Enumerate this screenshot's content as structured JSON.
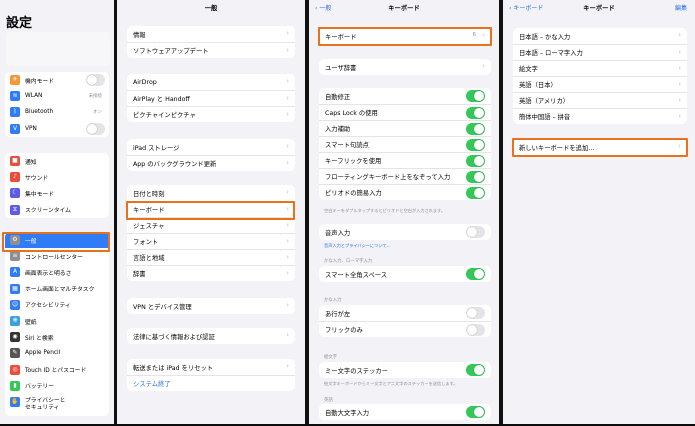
{
  "sidebar": {
    "title": "設定",
    "group1": [
      {
        "label": "機内モード",
        "icon": "airplane-icon",
        "glyph": "✈",
        "color": "#f29a38",
        "toggle": false
      },
      {
        "label": "WLAN",
        "icon": "wifi-icon",
        "glyph": "≋",
        "color": "#2f7cf6",
        "value": "未接続"
      },
      {
        "label": "Bluetooth",
        "icon": "bluetooth-icon",
        "glyph": "ᛒ",
        "color": "#2f7cf6",
        "value": "オン"
      },
      {
        "label": "VPN",
        "icon": "vpn-icon",
        "glyph": "V",
        "color": "#2f7cf6",
        "toggle": false
      }
    ],
    "group2": [
      {
        "label": "通知",
        "icon": "notifications-icon",
        "glyph": "■",
        "color": "#eb4d3d"
      },
      {
        "label": "サウンド",
        "icon": "sound-icon",
        "glyph": "♪",
        "color": "#eb4d3d"
      },
      {
        "label": "集中モード",
        "icon": "focus-moon-icon",
        "glyph": "☾",
        "color": "#5e5ce6"
      },
      {
        "label": "スクリーンタイム",
        "icon": "screen-time-icon",
        "glyph": "⧖",
        "color": "#5e5ce6"
      }
    ],
    "group3": [
      {
        "label": "一般",
        "icon": "gear-icon",
        "glyph": "⚙",
        "color": "#8e8e93",
        "selected": true
      },
      {
        "label": "コントロールセンター",
        "icon": "control-center-icon",
        "glyph": "≡",
        "color": "#8e8e93"
      },
      {
        "label": "画面表示と明るさ",
        "icon": "brightness-icon",
        "glyph": "A",
        "color": "#2f7cf6"
      },
      {
        "label": "ホーム画面とマルチタスク",
        "icon": "home-screen-icon",
        "glyph": "▦",
        "color": "#2f7cf6"
      },
      {
        "label": "アクセシビリティ",
        "icon": "accessibility-icon",
        "glyph": "☺",
        "color": "#2f7cf6"
      },
      {
        "label": "壁紙",
        "icon": "wallpaper-icon",
        "glyph": "❋",
        "color": "#3aa0e0"
      },
      {
        "label": "Siri と検索",
        "icon": "siri-icon",
        "glyph": "◉",
        "color": "#333"
      },
      {
        "label": "Apple Pencil",
        "icon": "pencil-icon",
        "glyph": "✎",
        "color": "#555"
      },
      {
        "label": "Touch ID とパスコード",
        "icon": "touch-id-icon",
        "glyph": "◎",
        "color": "#eb4d3d"
      },
      {
        "label": "バッテリー",
        "icon": "battery-icon",
        "glyph": "▮",
        "color": "#34c759"
      },
      {
        "label": "プライバシーと\nセキュリティ",
        "icon": "privacy-hand-icon",
        "glyph": "✋",
        "color": "#2f7cf6"
      }
    ]
  },
  "general": {
    "title": "一般",
    "groups": [
      [
        "情報",
        "ソフトウェアアップデート"
      ],
      [
        "AirDrop",
        "AirPlay と Handoff",
        "ピクチャインピクチャ"
      ],
      [
        "iPad ストレージ",
        "App のバックグラウンド更新"
      ],
      [
        "日付と時刻",
        "キーボード",
        "ジェスチャ",
        "フォント",
        "言語と地域",
        "辞書"
      ],
      [
        "VPN とデバイス管理"
      ],
      [
        "法律に基づく情報および認証"
      ],
      [
        "転送または iPad をリセット",
        "システム終了"
      ]
    ]
  },
  "keyboard": {
    "back": "一般",
    "title": "キーボード",
    "keyboards": {
      "label": "キーボード",
      "value": "6"
    },
    "user_dict": "ユーザ辞書",
    "toggles": [
      {
        "label": "自動修正",
        "on": true
      },
      {
        "label": "Caps Lock の使用",
        "on": true
      },
      {
        "label": "入力補助",
        "on": true
      },
      {
        "label": "スマート句読点",
        "on": true
      },
      {
        "label": "キーフリックを使用",
        "on": true
      },
      {
        "label": "フローティングキーボード上をなぞって入力",
        "on": true
      },
      {
        "label": "ピリオドの簡易入力",
        "on": true
      }
    ],
    "toggles_note": "空白キーをダブルタップするとピリオドと空白が入力されます。",
    "dictation": {
      "label": "音声入力",
      "on": false
    },
    "dictation_note": "音声入力とプライバシーについて…",
    "kana_header": "かな入力、ローマ字入力",
    "smart_space": {
      "label": "スマート全角スペース",
      "on": true
    },
    "kana_header2": "かな入力",
    "kana": [
      {
        "label": "あ行が左",
        "on": false
      },
      {
        "label": "フリックのみ",
        "on": false
      }
    ],
    "emoji_header": "絵文字",
    "memoji": {
      "label": "ミー文字のステッカー",
      "on": true
    },
    "memoji_note": "絵文字キーボードからミー文字とアニ文字のステッカーを送信します。",
    "english_header": "英語",
    "auto_caps": {
      "label": "自動大文字入力",
      "on": true
    }
  },
  "keyboards_list": {
    "back": "キーボード",
    "title": "キーボード",
    "edit": "編集",
    "items": [
      "日本語 – かな入力",
      "日本語 – ローマ字入力",
      "絵文字",
      "英語（日本）",
      "英語（アメリカ）",
      "簡体中国語 – 拼音"
    ],
    "add": "新しいキーボードを追加..."
  }
}
